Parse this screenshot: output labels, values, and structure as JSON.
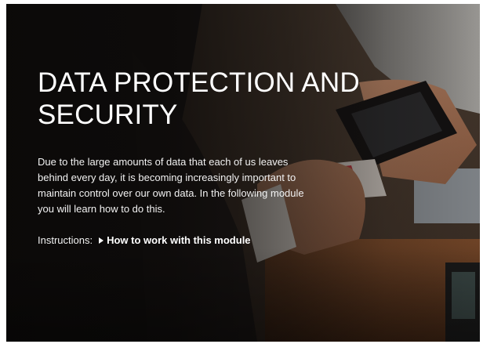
{
  "hero": {
    "title": "DATA PROTECTION AND SECURITY",
    "intro": "Due to the large amounts of data that each of us leaves behind every day, it is becoming increasingly important to maintain control over our own data. In the following module you will learn how to do this."
  },
  "instructions": {
    "label": "Instructions:",
    "link_label": "How to work with this module",
    "link_icon": "play-triangle-icon"
  },
  "colors": {
    "text": "#ffffff",
    "overlay": "#0a0807"
  }
}
